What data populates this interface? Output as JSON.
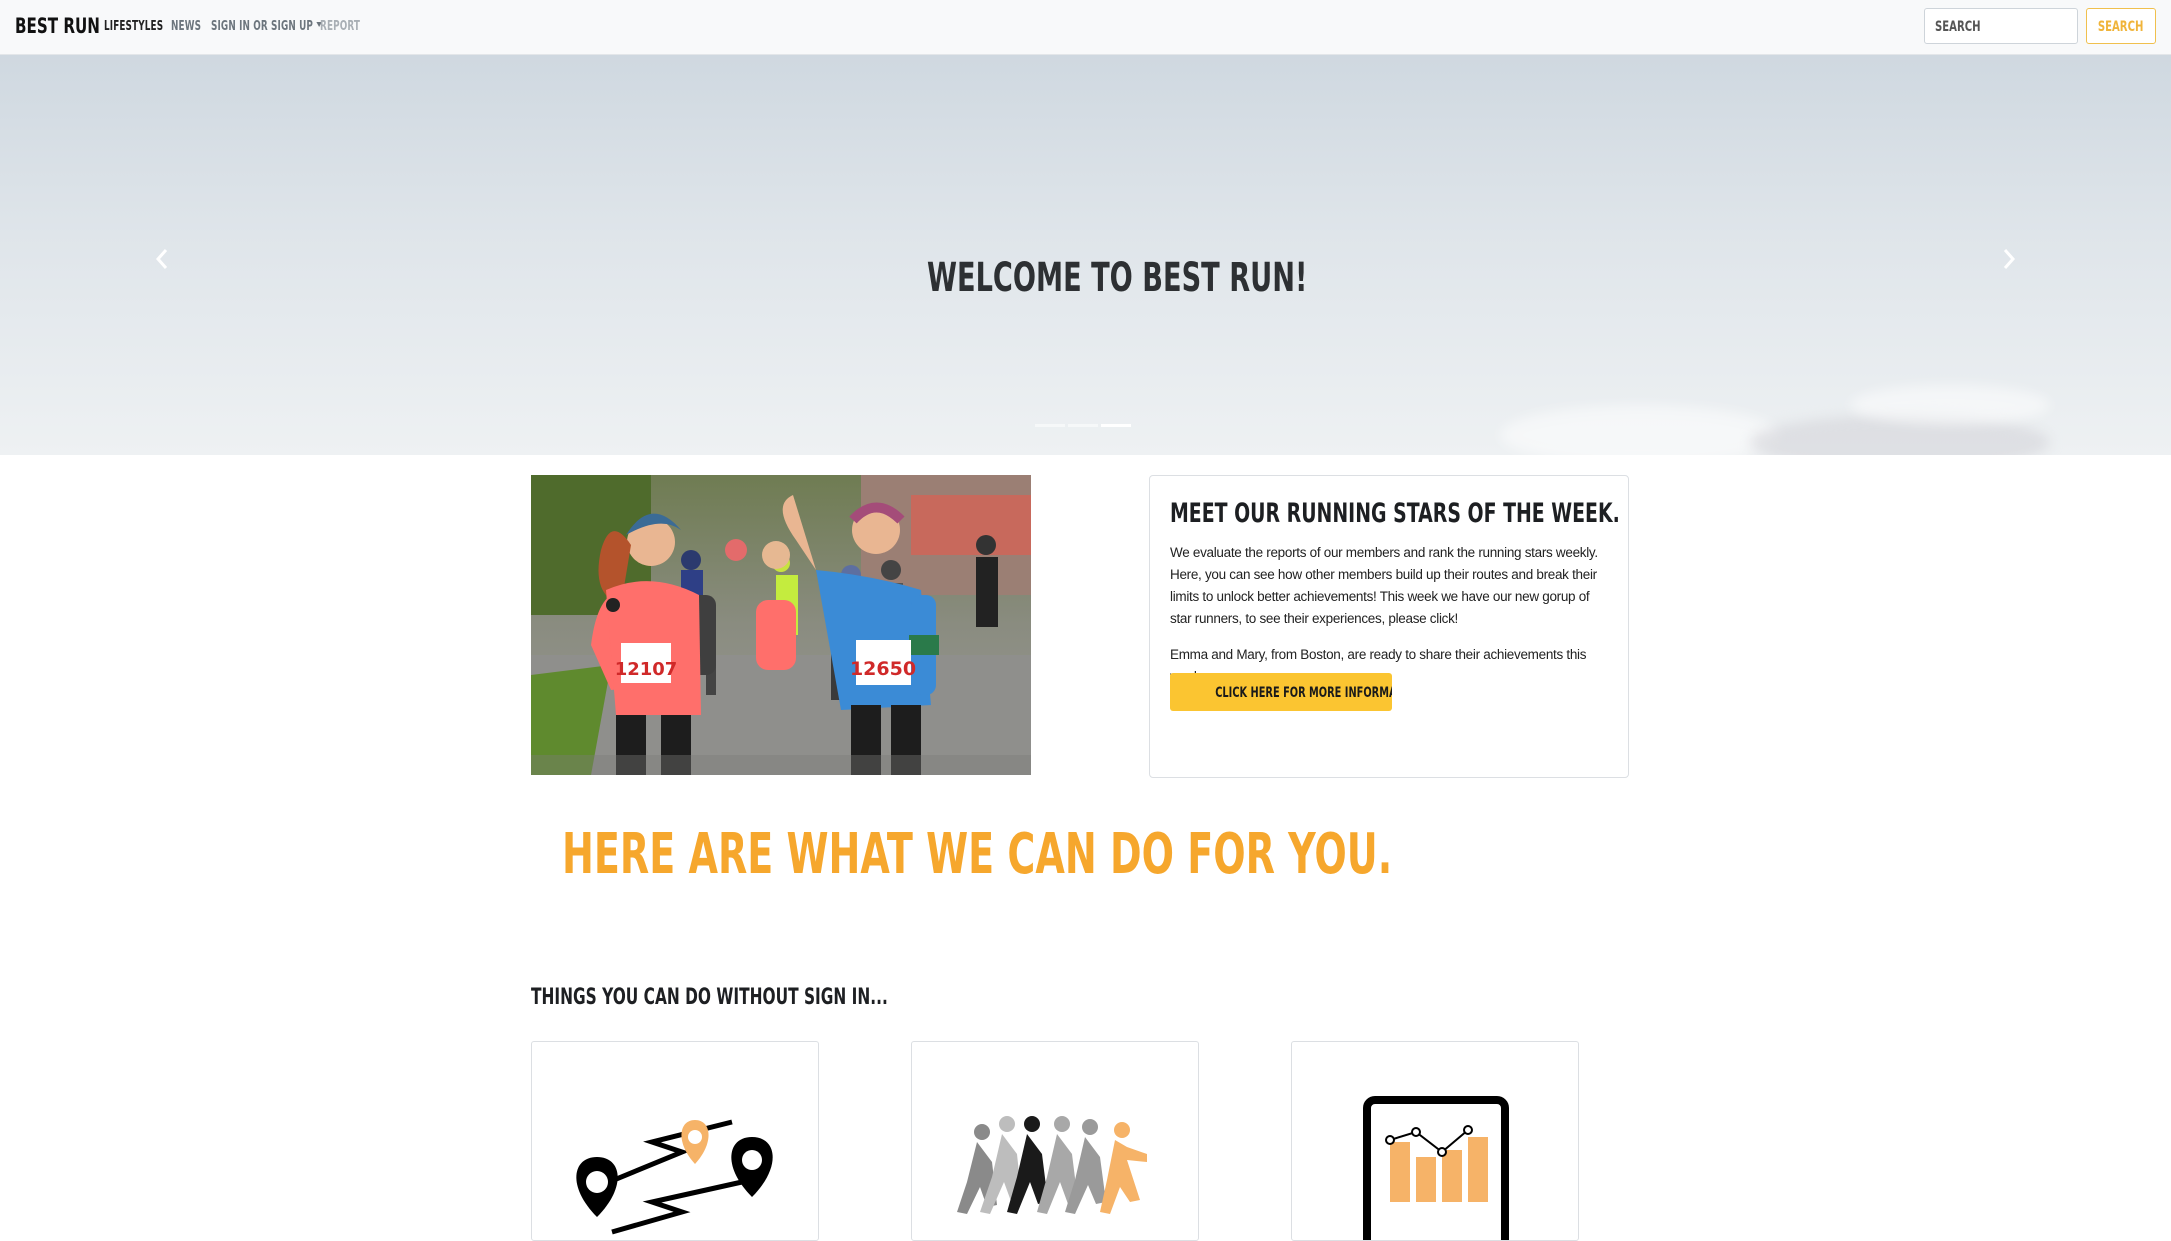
{
  "navbar": {
    "brand": "BEST RUN",
    "items": [
      {
        "label": "LIFESTYLES"
      },
      {
        "label": "NEWS"
      },
      {
        "label": "SIGN IN OR SIGN UP"
      },
      {
        "label": "REPORT"
      }
    ],
    "search_placeholder": "SEARCH",
    "search_button": "SEARCH"
  },
  "hero": {
    "title": "WELCOME TO BEST RUN!",
    "prev_icon": "chevron-left-icon",
    "next_icon": "chevron-right-icon",
    "slides": 3,
    "active_slide": 3
  },
  "photo": {
    "bib_left": "12107",
    "bib_right": "12650"
  },
  "stars_card": {
    "title": "MEET OUR RUNNING STARS OF THE WEEK.",
    "text1": "We evaluate the reports of our members and rank the running stars weekly. Here, you can see how other members build up their routes and break their limits to unlock better achievements! This week we have our new gorup of star runners, to see their experiences, please click!",
    "text2": "Emma and Mary, from Boston, are ready to share their achievements this week.",
    "button": "CLICK HERE FOR MORE INFORMATION."
  },
  "services": {
    "heading": "HERE ARE WHAT WE CAN DO FOR YOU.",
    "subheading": "THINGS YOU CAN DO WITHOUT SIGN IN...",
    "features": [
      {
        "icon": "route-map-icon"
      },
      {
        "icon": "runners-group-icon"
      },
      {
        "icon": "report-chart-icon"
      }
    ]
  },
  "colors": {
    "accent": "#f6a72d",
    "button": "#fbc531",
    "navbar_bg": "#f8f9fa"
  }
}
